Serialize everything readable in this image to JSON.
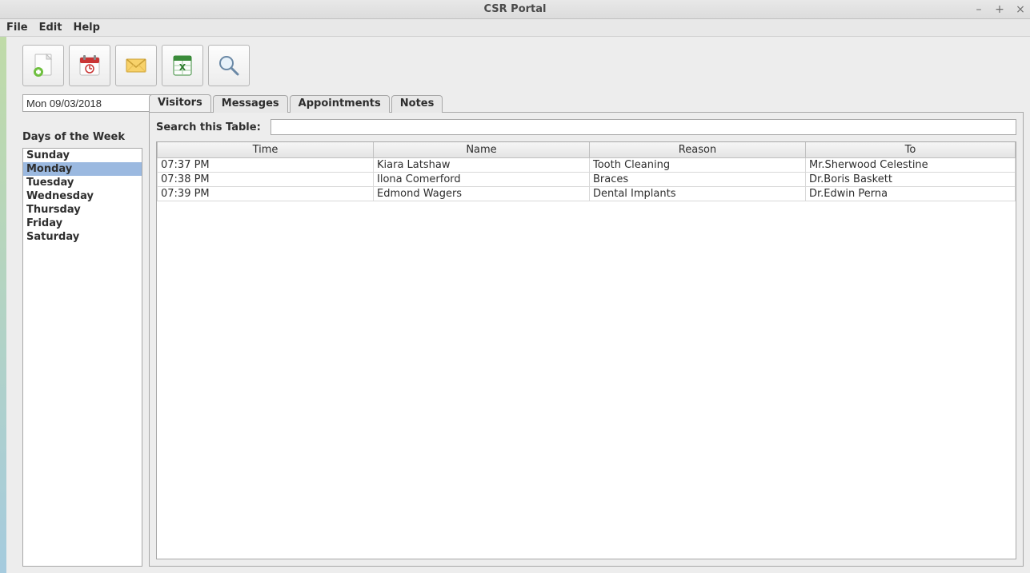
{
  "window": {
    "title": "CSR Portal"
  },
  "menu": {
    "file": "File",
    "edit": "Edit",
    "help": "Help"
  },
  "toolbar_icons": {
    "new": "new-doc-icon",
    "calendar": "calendar-icon",
    "mail": "mail-icon",
    "excel": "excel-icon",
    "search": "search-icon"
  },
  "date": {
    "value": "Mon 09/03/2018"
  },
  "days": {
    "label": "Days of the Week",
    "items": [
      "Sunday",
      "Monday",
      "Tuesday",
      "Wednesday",
      "Thursday",
      "Friday",
      "Saturday"
    ],
    "selected_index": 1
  },
  "tabs": {
    "items": [
      "Visitors",
      "Messages",
      "Appointments",
      "Notes"
    ],
    "active_index": 0
  },
  "search": {
    "label": "Search this Table:",
    "value": ""
  },
  "table": {
    "columns": [
      "Time",
      "Name",
      "Reason",
      "To"
    ],
    "rows": [
      {
        "time": "07:37 PM",
        "name": "Kiara Latshaw",
        "reason": "Tooth Cleaning",
        "to": "Mr.Sherwood Celestine"
      },
      {
        "time": "07:38 PM",
        "name": "Ilona Comerford",
        "reason": "Braces",
        "to": "Dr.Boris Baskett"
      },
      {
        "time": "07:39 PM",
        "name": "Edmond Wagers",
        "reason": "Dental Implants",
        "to": "Dr.Edwin Perna"
      }
    ]
  }
}
